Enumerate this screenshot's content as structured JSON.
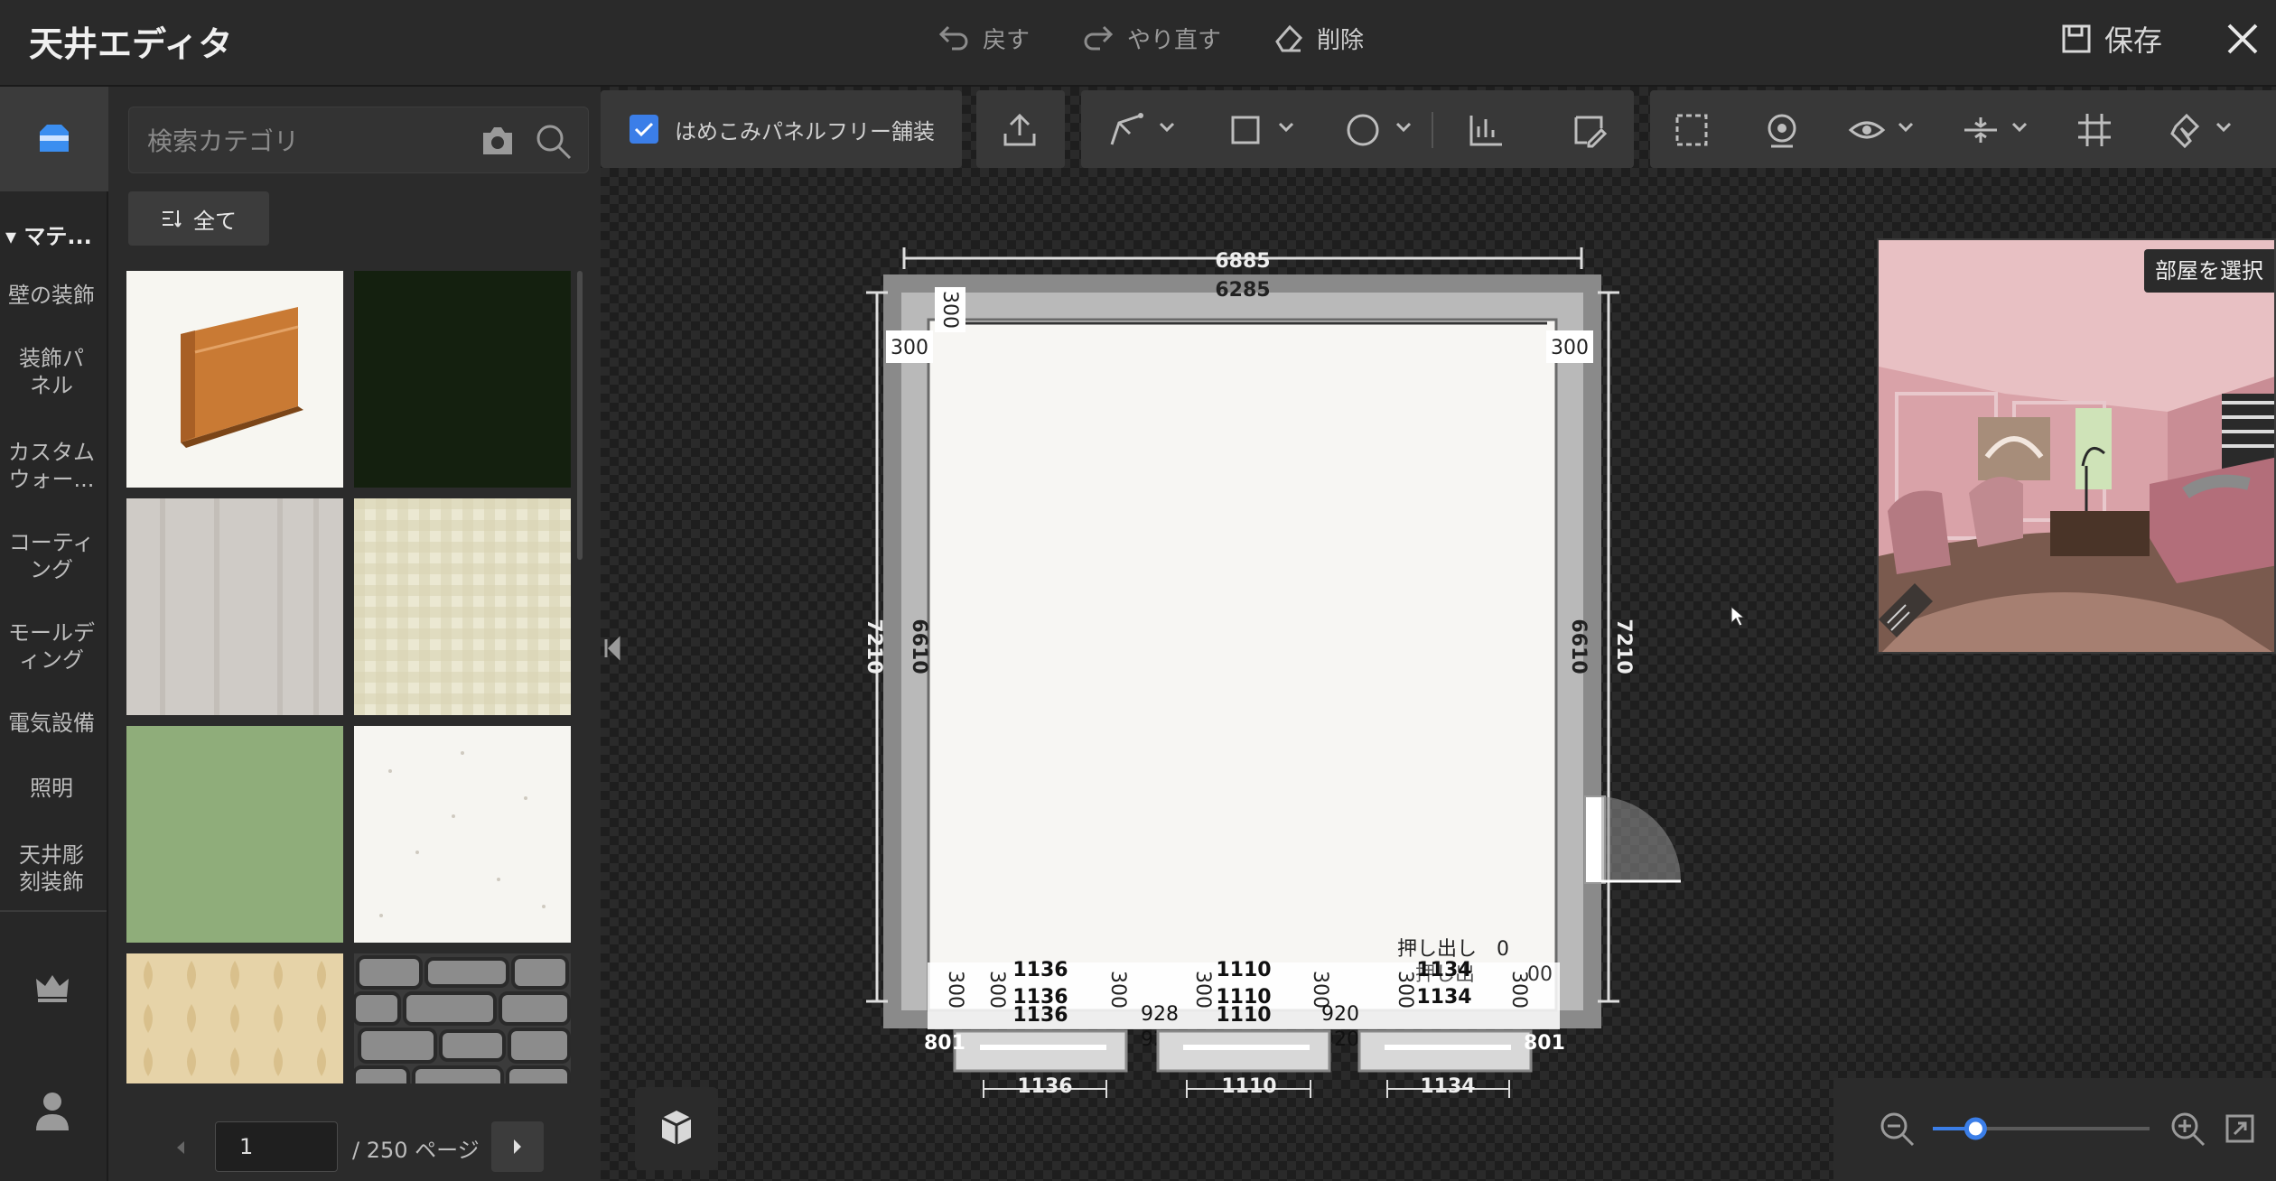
{
  "app": {
    "title": "天井エディタ"
  },
  "topbar": {
    "undo_label": "戻す",
    "redo_label": "やり直す",
    "delete_label": "削除",
    "save_label": "保存"
  },
  "rail": {
    "section_label": "マテ...",
    "items": [
      "壁の装飾",
      "装飾パネル",
      "カスタムウォー...",
      "コーティング",
      "モールディング",
      "電気設備",
      "照明",
      "天井彫刻装飾"
    ]
  },
  "catalog": {
    "search_placeholder": "検索カテゴリ",
    "filter_label": "全て",
    "page_value": "1",
    "page_total": "/ 250 ページ",
    "tiles": [
      "wood-baseboard",
      "dark-green",
      "light-gray-plaster",
      "beige-check",
      "sage-green",
      "white-speckle",
      "beige-damask",
      "gray-stone"
    ]
  },
  "toolbar": {
    "paneless_label": "はめこみパネルフリー舗装",
    "paneless_checked": true
  },
  "preview": {
    "select_room_label": "部屋を選択"
  },
  "plan": {
    "dim_outer_width": "6885",
    "dim_inner_width": "6285",
    "dim_outer_height_left": "7210",
    "dim_inner_height_left": "6610",
    "dim_outer_height_right": "7210",
    "dim_inner_height_right": "6610",
    "offset_top": "300",
    "offset_left": "300",
    "offset_right": "300",
    "bottom_300": "300",
    "win1_width": "1136",
    "win2_width": "1110",
    "win3_width": "1134",
    "win1_inner": "928",
    "win2_inner": "920",
    "side_801": "801",
    "extrude_label": "押し出し",
    "extrude_value": "0",
    "extrude_partial": "押し出",
    "right_partial": "00"
  },
  "zoom": {
    "level": 0.17
  },
  "colors": {
    "accent": "#3b7ee8",
    "rail_active": "#3b3b3b"
  }
}
